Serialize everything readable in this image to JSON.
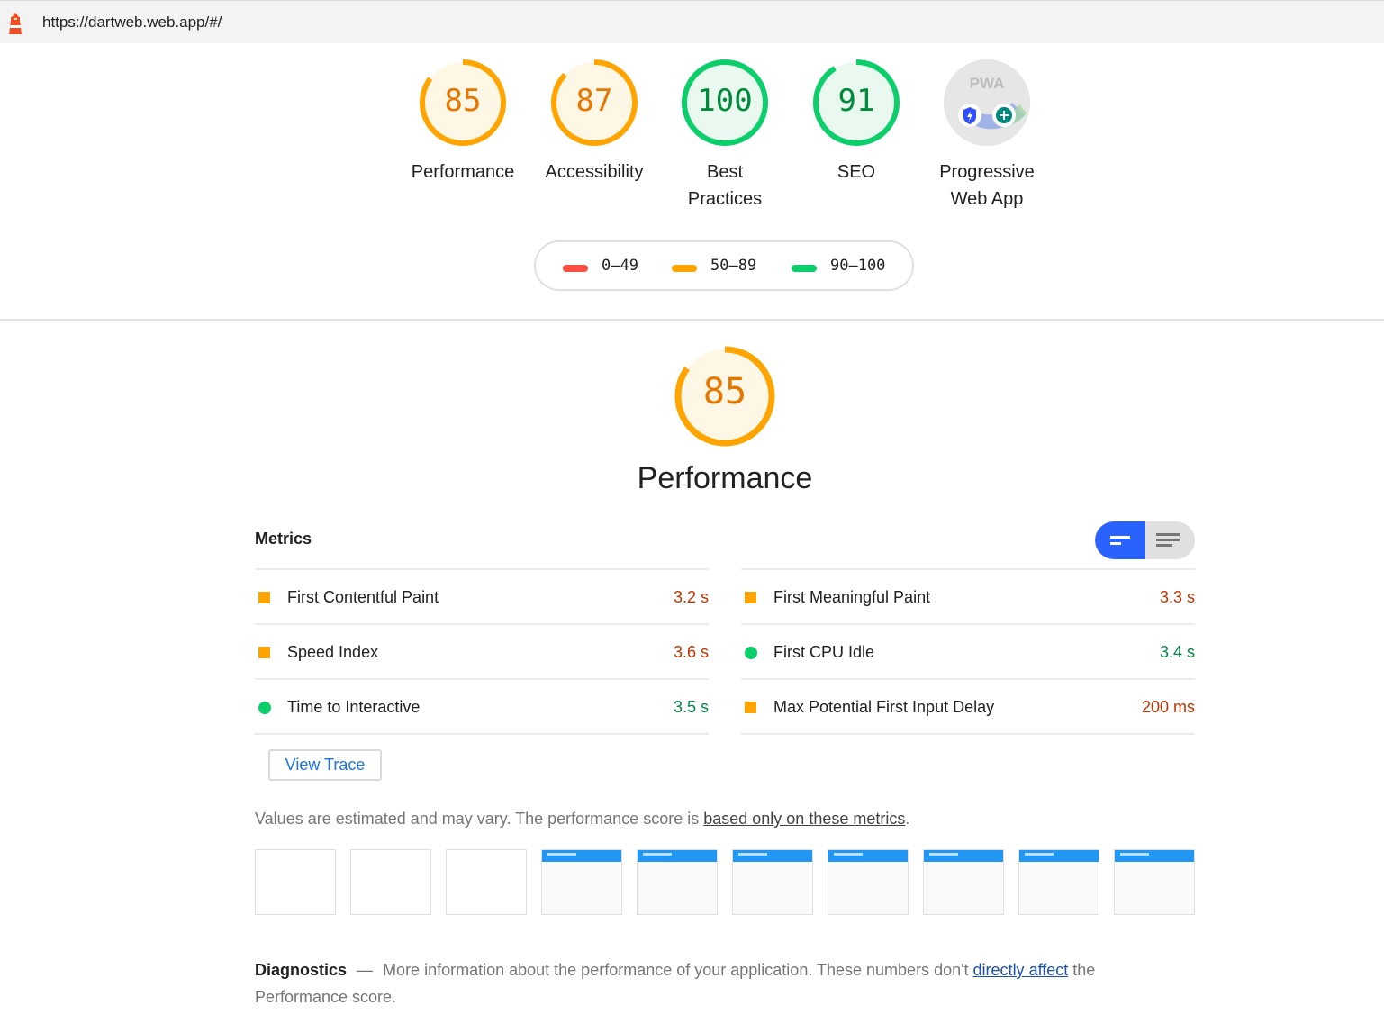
{
  "address_bar": {
    "url": "https://dartweb.web.app/#/"
  },
  "gauges": [
    {
      "score": "85",
      "label": "Performance",
      "color": "#ffa400",
      "fill": "#fff7e6",
      "ratio": 0.85
    },
    {
      "score": "87",
      "label": "Accessibility",
      "color": "#ffa400",
      "fill": "#fff7e6",
      "ratio": 0.87
    },
    {
      "score": "100",
      "label": "Best Practices",
      "color": "#0cce6b",
      "fill": "#e9f9ef",
      "ratio": 1.0
    },
    {
      "score": "91",
      "label": "SEO",
      "color": "#0cce6b",
      "fill": "#e9f9ef",
      "ratio": 0.91
    }
  ],
  "pwa": {
    "badge_text": "PWA",
    "label": "Progressive Web App"
  },
  "legend": [
    {
      "range": "0–49",
      "color": "#ff4e42"
    },
    {
      "range": "50–89",
      "color": "#ffa400"
    },
    {
      "range": "90–100",
      "color": "#0cce6b"
    }
  ],
  "category": {
    "score": "85",
    "title": "Performance",
    "ratio": 0.85
  },
  "metrics": {
    "heading": "Metrics",
    "left": [
      {
        "name": "First Contentful Paint",
        "value": "3.2 s",
        "status": "average"
      },
      {
        "name": "Speed Index",
        "value": "3.6 s",
        "status": "average"
      },
      {
        "name": "Time to Interactive",
        "value": "3.5 s",
        "status": "pass"
      }
    ],
    "right": [
      {
        "name": "First Meaningful Paint",
        "value": "3.3 s",
        "status": "average"
      },
      {
        "name": "First CPU Idle",
        "value": "3.4 s",
        "status": "pass"
      },
      {
        "name": "Max Potential First Input Delay",
        "value": "200 ms",
        "status": "average"
      }
    ]
  },
  "view_trace_label": "View Trace",
  "note": {
    "text": "Values are estimated and may vary. The performance score is ",
    "link": "based only on these metrics",
    "end": "."
  },
  "filmstrip": [
    "blank",
    "blank",
    "blank",
    "loaded",
    "loaded",
    "loaded",
    "loaded",
    "loaded",
    "loaded",
    "loaded"
  ],
  "diagnostics": {
    "title": "Diagnostics",
    "dash": "—",
    "text": "More information about the performance of your application. These numbers don't ",
    "link": "directly affect",
    "end": " the Performance score."
  }
}
